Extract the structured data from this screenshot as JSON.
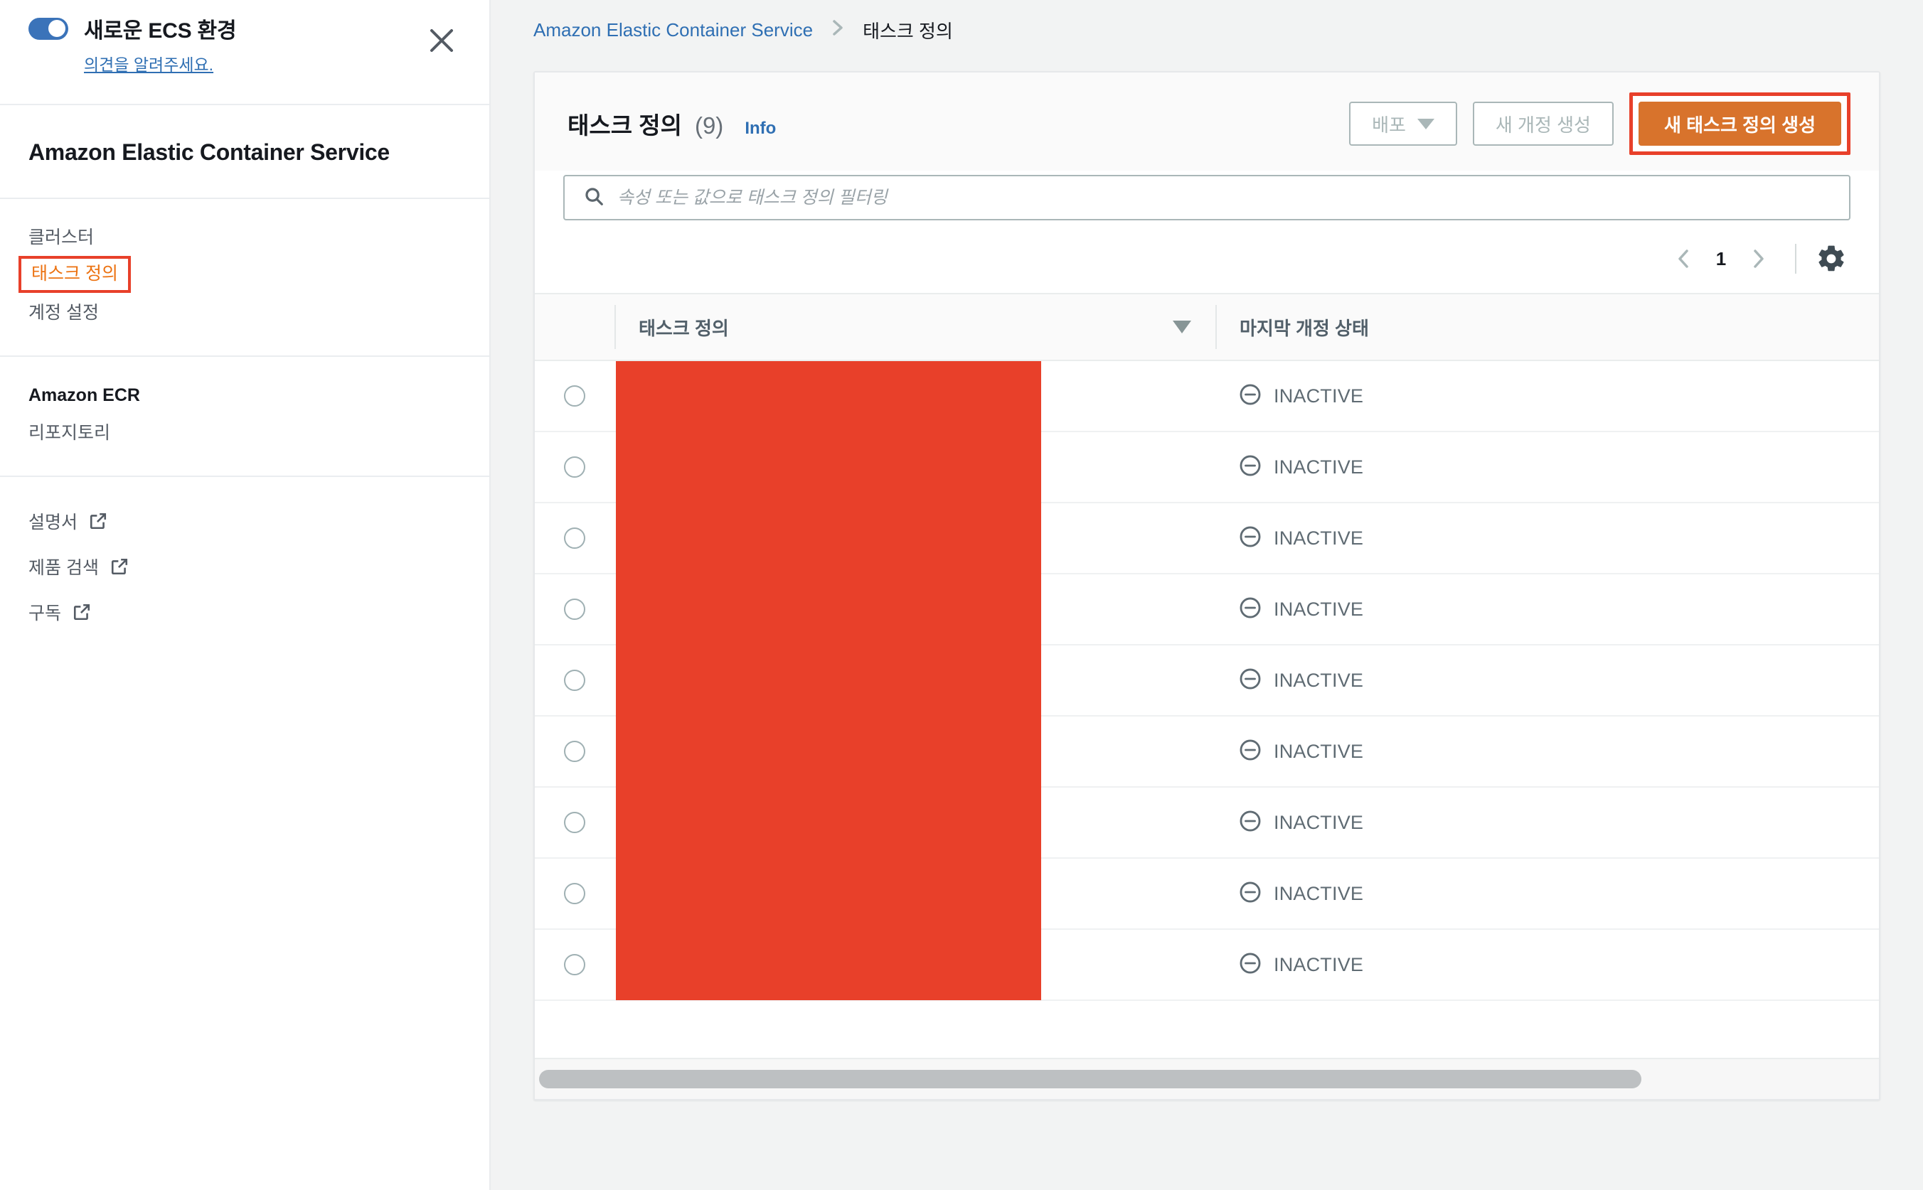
{
  "sidebar": {
    "promo": {
      "toggle_state": "on",
      "title": "새로운 ECS 환경",
      "feedback_link": "의견을 알려주세요.",
      "close_icon": "close-icon"
    },
    "service_title": "Amazon Elastic Container Service",
    "nav_primary": [
      {
        "label": "클러스터",
        "highlighted": false
      },
      {
        "label": "태스크 정의",
        "highlighted": true
      },
      {
        "label": "계정 설정",
        "highlighted": false
      }
    ],
    "ecr_group": {
      "heading": "Amazon ECR",
      "items": [
        {
          "label": "리포지토리"
        }
      ]
    },
    "external_links": [
      {
        "label": "설명서",
        "icon": "external-link-icon"
      },
      {
        "label": "제품 검색",
        "icon": "external-link-icon"
      },
      {
        "label": "구독",
        "icon": "external-link-icon"
      }
    ]
  },
  "breadcrumb": {
    "root": "Amazon Elastic Container Service",
    "separator": "›",
    "current": "태스크 정의"
  },
  "panel": {
    "title": "태스크 정의",
    "count": "(9)",
    "info_label": "Info",
    "actions": {
      "deploy_label": "배포",
      "deploy_caret": "chevron-down-icon",
      "new_revision_label": "새 개정 생성",
      "create_label": "새 태스크 정의 생성"
    },
    "search": {
      "placeholder": "속성 또는 값으로 태스크 정의 필터링",
      "value": "",
      "icon": "search-icon"
    },
    "pagination": {
      "prev_icon": "chevron-left-icon",
      "page": "1",
      "next_icon": "chevron-right-icon",
      "settings_icon": "gear-icon"
    },
    "table": {
      "columns": [
        {
          "key": "select",
          "label": ""
        },
        {
          "key": "name",
          "label": "태스크 정의",
          "sort_icon": "sort-descending-icon"
        },
        {
          "key": "status",
          "label": "마지막 개정 상태"
        }
      ],
      "rows": [
        {
          "name": "",
          "name_redacted": true,
          "status": "INACTIVE",
          "status_icon": "minus-circle-icon"
        },
        {
          "name": "",
          "name_redacted": true,
          "status": "INACTIVE",
          "status_icon": "minus-circle-icon"
        },
        {
          "name": "",
          "name_redacted": true,
          "status": "INACTIVE",
          "status_icon": "minus-circle-icon"
        },
        {
          "name": "",
          "name_redacted": true,
          "status": "INACTIVE",
          "status_icon": "minus-circle-icon"
        },
        {
          "name": "",
          "name_redacted": true,
          "status": "INACTIVE",
          "status_icon": "minus-circle-icon"
        },
        {
          "name": "",
          "name_redacted": true,
          "status": "INACTIVE",
          "status_icon": "minus-circle-icon"
        },
        {
          "name": "",
          "name_redacted": true,
          "status": "INACTIVE",
          "status_icon": "minus-circle-icon"
        },
        {
          "name": "",
          "name_redacted": true,
          "status": "INACTIVE",
          "status_icon": "minus-circle-icon"
        },
        {
          "name": "",
          "name_redacted": true,
          "status": "INACTIVE",
          "status_icon": "minus-circle-icon"
        }
      ]
    }
  },
  "colors": {
    "accent_orange": "#ec7211",
    "primary_button": "#d8732c",
    "highlight_red": "#e8402a",
    "link_blue": "#2f6fb3",
    "toggle_blue": "#3b73b9",
    "text_dark": "#16191f",
    "text_muted": "#545b64"
  }
}
